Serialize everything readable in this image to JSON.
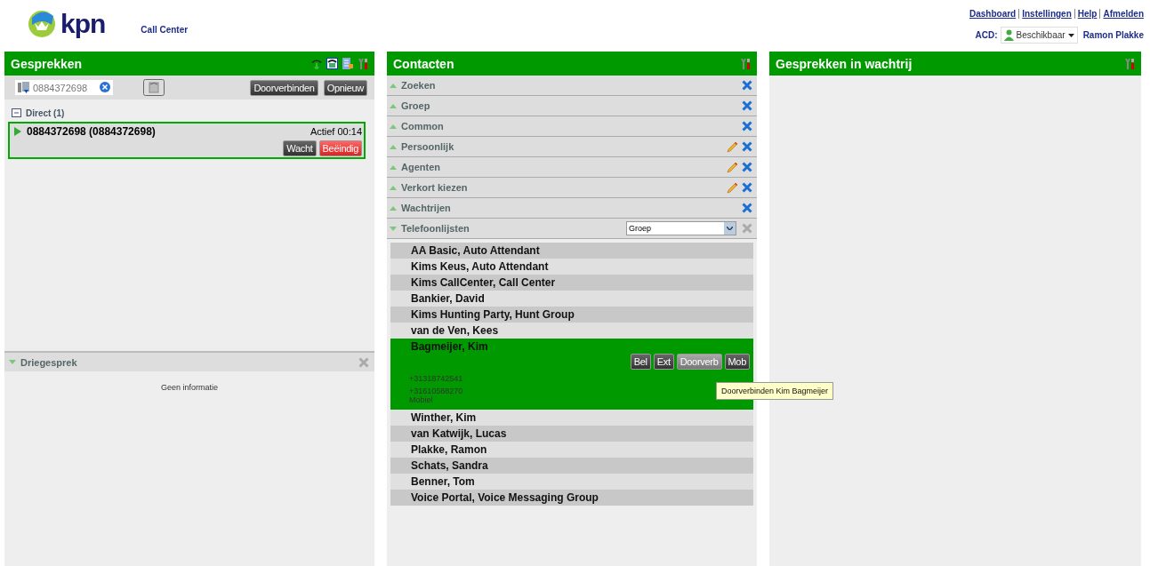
{
  "header": {
    "brand": "kpn",
    "product": "Call Center",
    "links": [
      "Dashboard",
      "Instellingen",
      "Help",
      "Afmelden"
    ],
    "acd_label": "ACD:",
    "acd_status": "Beschikbaar",
    "user": "Ramon Plakke"
  },
  "calls": {
    "title": "Gesprekken",
    "dial": {
      "value": "0884372698"
    },
    "buttons": [
      "Doorverbinden",
      "Opnieuw"
    ],
    "group": {
      "label": "Direct (1)",
      "expanded": true
    },
    "items": [
      {
        "number": "0884372698 (0884372698)",
        "status": "Actief 00:14",
        "selected": true,
        "actions": [
          {
            "label": "Wacht",
            "kind": "normal"
          },
          {
            "label": "Beëindig",
            "kind": "danger"
          }
        ]
      }
    ],
    "conference": {
      "title": "Driegesprek",
      "expanded": true,
      "message": "Geen informatie"
    }
  },
  "contacts": {
    "title": "Contacten",
    "sections": [
      {
        "label": "Zoeken",
        "expanded": false,
        "editable": false,
        "disabled": false
      },
      {
        "label": "Groep",
        "expanded": false,
        "editable": false,
        "disabled": false
      },
      {
        "label": "Common",
        "expanded": false,
        "editable": false,
        "disabled": false
      },
      {
        "label": "Persoonlijk",
        "expanded": false,
        "editable": true,
        "disabled": false
      },
      {
        "label": "Agenten",
        "expanded": false,
        "editable": true,
        "disabled": false
      },
      {
        "label": "Verkort kiezen",
        "expanded": false,
        "editable": true,
        "disabled": false
      },
      {
        "label": "Wachtrijen",
        "expanded": false,
        "editable": false,
        "disabled": false
      },
      {
        "label": "Telefoonlijsten",
        "expanded": true,
        "editable": false,
        "disabled": true,
        "filter": "Groep"
      }
    ],
    "entries": [
      {
        "name": "AA Basic, Auto Attendant",
        "selected": false
      },
      {
        "name": "Kims Keus, Auto Attendant",
        "selected": false
      },
      {
        "name": "Kims CallCenter, Call Center",
        "selected": false
      },
      {
        "name": "Bankier, David",
        "selected": false
      },
      {
        "name": "Kims Hunting Party, Hunt Group",
        "selected": false
      },
      {
        "name": "van de Ven, Kees",
        "selected": false
      },
      {
        "name": "Bagmeijer, Kim",
        "selected": true,
        "actions": [
          {
            "label": "Bel",
            "hovered": false
          },
          {
            "label": "Ext",
            "hovered": false
          },
          {
            "label": "Doorverb",
            "hovered": true
          },
          {
            "label": "Mob",
            "hovered": false
          }
        ],
        "phones": [
          {
            "number": "+31318742541"
          },
          {
            "number": "+31610588270",
            "label": "Mobiel"
          }
        ]
      },
      {
        "name": "Winther, Kim",
        "selected": false
      },
      {
        "name": "van Katwijk, Lucas",
        "selected": false
      },
      {
        "name": "Plakke, Ramon",
        "selected": false
      },
      {
        "name": "Schats, Sandra",
        "selected": false
      },
      {
        "name": "Benner, Tom",
        "selected": false
      },
      {
        "name": "Voice Portal, Voice Messaging Group",
        "selected": false
      }
    ],
    "tooltip": "Doorverbinden Kim Bagmeijer"
  },
  "queue": {
    "title": "Gesprekken in wachtrij"
  }
}
